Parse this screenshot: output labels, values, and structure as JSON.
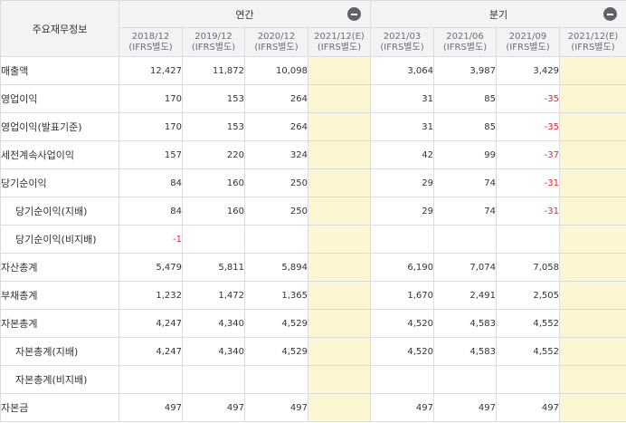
{
  "table": {
    "title": "주요재무정보",
    "groups": {
      "annual": "연간",
      "quarter": "분기"
    },
    "columns": [
      {
        "period": "2018/12",
        "basis": "(IFRS별도)"
      },
      {
        "period": "2019/12",
        "basis": "(IFRS별도)"
      },
      {
        "period": "2020/12",
        "basis": "(IFRS별도)"
      },
      {
        "period": "2021/12(E)",
        "basis": "(IFRS별도)"
      },
      {
        "period": "2021/03",
        "basis": "(IFRS별도)"
      },
      {
        "period": "2021/06",
        "basis": "(IFRS별도)"
      },
      {
        "period": "2021/09",
        "basis": "(IFRS별도)"
      },
      {
        "period": "2021/12(E)",
        "basis": "(IFRS별도)"
      }
    ],
    "rows": [
      {
        "label": "매출액",
        "values": [
          "12,427",
          "11,872",
          "10,098",
          "",
          "3,064",
          "3,987",
          "3,429",
          ""
        ]
      },
      {
        "label": "영업이익",
        "values": [
          "170",
          "153",
          "264",
          "",
          "31",
          "85",
          "-35",
          ""
        ]
      },
      {
        "label": "영업이익(발표기준)",
        "values": [
          "170",
          "153",
          "264",
          "",
          "31",
          "85",
          "-35",
          ""
        ]
      },
      {
        "label": "세전계속사업이익",
        "values": [
          "157",
          "220",
          "324",
          "",
          "42",
          "99",
          "-37",
          ""
        ]
      },
      {
        "label": "당기순이익",
        "values": [
          "84",
          "160",
          "250",
          "",
          "29",
          "74",
          "-31",
          ""
        ]
      },
      {
        "label": "당기순이익(지배)",
        "values": [
          "84",
          "160",
          "250",
          "",
          "29",
          "74",
          "-31",
          ""
        ]
      },
      {
        "label": "당기순이익(비지배)",
        "values": [
          "-1",
          "",
          "",
          "",
          "",
          "",
          "",
          ""
        ]
      },
      {
        "label": "자산총계",
        "values": [
          "5,479",
          "5,811",
          "5,894",
          "",
          "6,190",
          "7,074",
          "7,058",
          ""
        ]
      },
      {
        "label": "부채총계",
        "values": [
          "1,232",
          "1,472",
          "1,365",
          "",
          "1,670",
          "2,491",
          "2,505",
          ""
        ]
      },
      {
        "label": "자본총계",
        "values": [
          "4,247",
          "4,340",
          "4,529",
          "",
          "4,520",
          "4,583",
          "4,552",
          ""
        ]
      },
      {
        "label": "자본총계(지배)",
        "values": [
          "4,247",
          "4,340",
          "4,529",
          "",
          "4,520",
          "4,583",
          "4,552",
          ""
        ]
      },
      {
        "label": "자본총계(비지배)",
        "values": [
          "",
          "",
          "",
          "",
          "",
          "",
          "",
          ""
        ]
      },
      {
        "label": "자본금",
        "values": [
          "497",
          "497",
          "497",
          "",
          "497",
          "497",
          "497",
          ""
        ]
      }
    ]
  },
  "colors": {
    "header_bg": "#f2f3f5",
    "estimate_bg": "#fcf7d2",
    "negative": "#e0262e",
    "border": "#d9dde2"
  }
}
